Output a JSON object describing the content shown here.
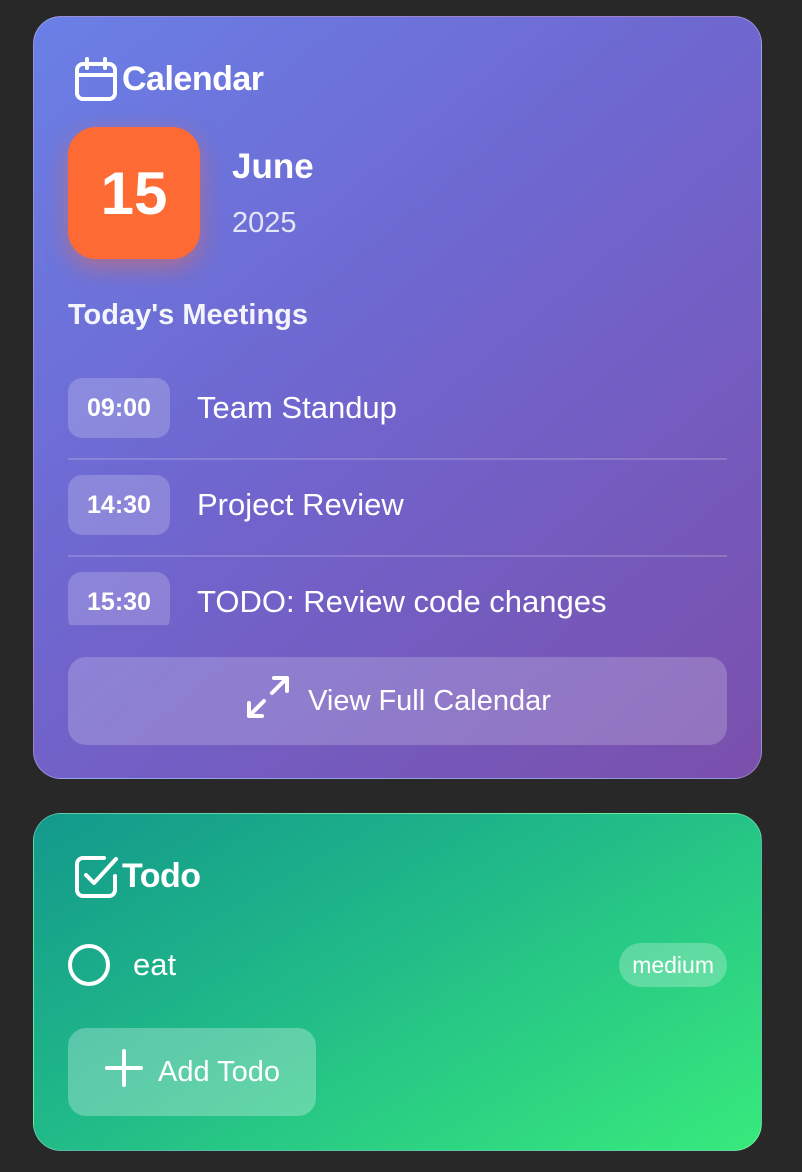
{
  "calendar": {
    "title": "Calendar",
    "day": "15",
    "month": "June",
    "year": "2025",
    "meetings_heading": "Today's Meetings",
    "meetings": [
      {
        "time": "09:00",
        "title": "Team Standup"
      },
      {
        "time": "14:30",
        "title": "Project Review"
      },
      {
        "time": "15:30",
        "title": "TODO: Review code changes"
      }
    ],
    "view_full_label": "View Full Calendar",
    "icon": "calendar-icon",
    "accent_color": "#fe6a34"
  },
  "todo": {
    "title": "Todo",
    "icon": "checkbox-icon",
    "items": [
      {
        "text": "eat",
        "priority": "medium",
        "done": false
      }
    ],
    "add_label": "Add Todo"
  },
  "colors": {
    "background": "#282828",
    "calendar_gradient": [
      "#6a80e6",
      "#7a4fac"
    ],
    "todo_gradient": [
      "#13998c",
      "#38ea7c"
    ]
  }
}
